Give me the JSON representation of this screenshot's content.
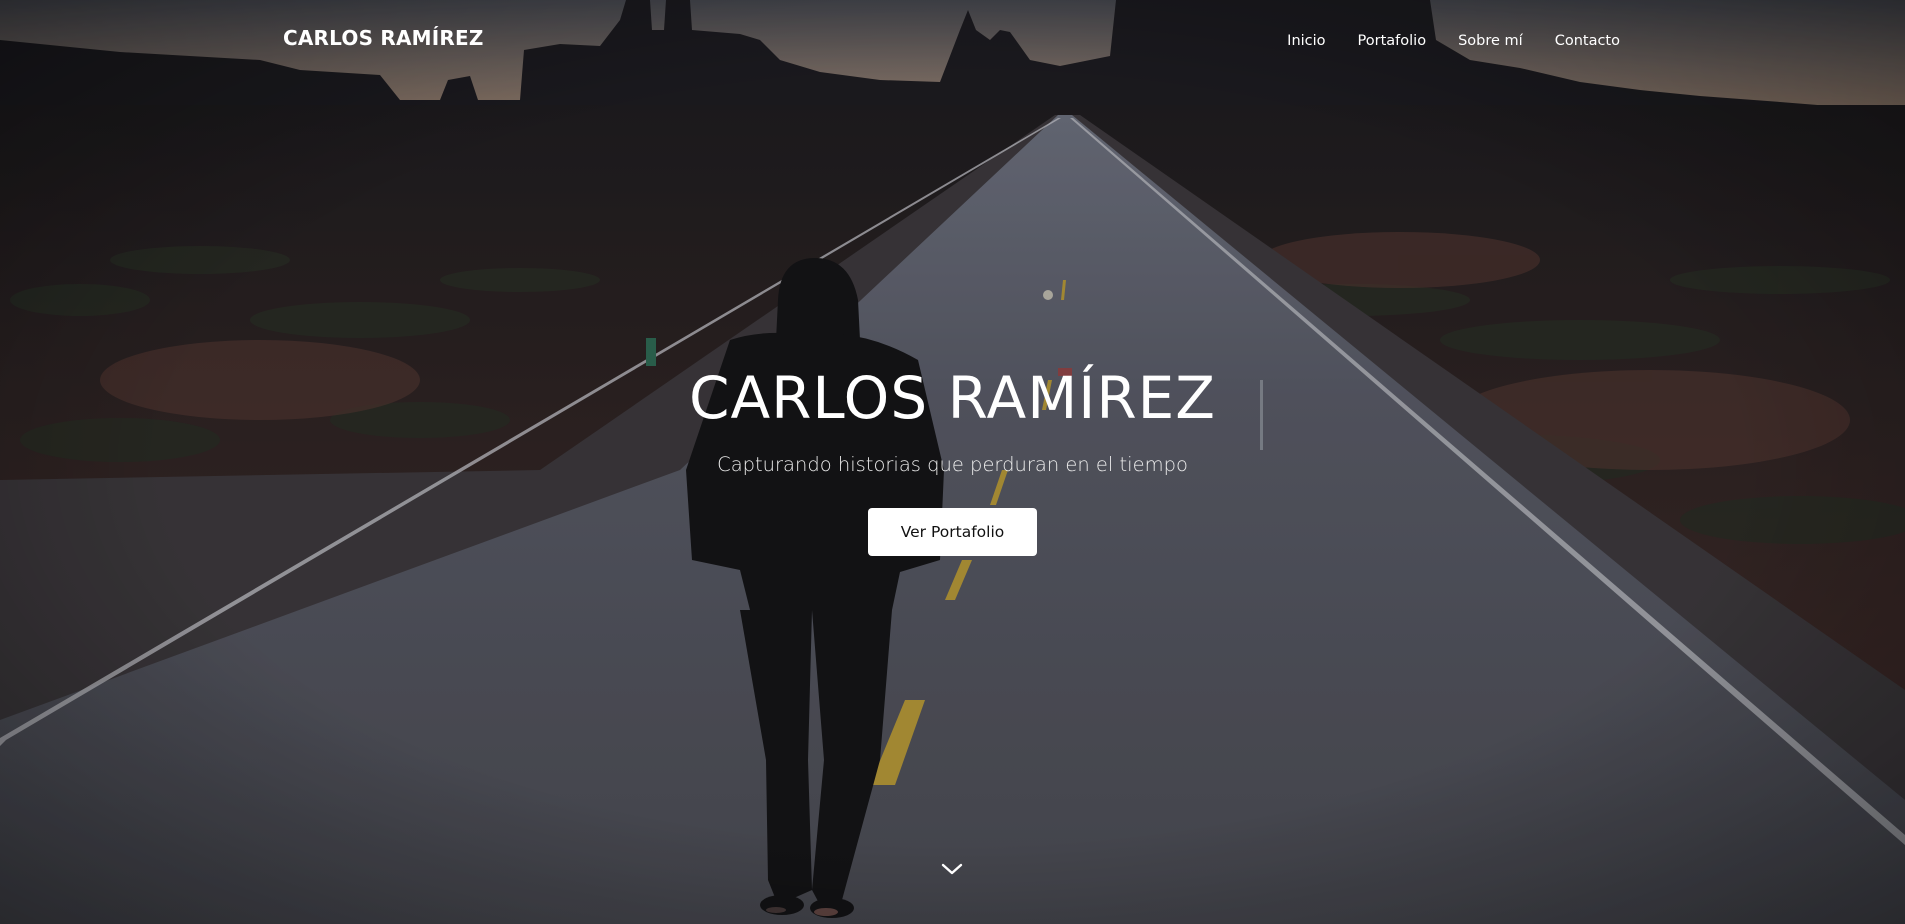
{
  "brand": {
    "name": "CARLOS RAMÍREZ"
  },
  "nav": {
    "items": [
      {
        "label": "Inicio"
      },
      {
        "label": "Portafolio"
      },
      {
        "label": "Sobre mí"
      },
      {
        "label": "Contacto"
      }
    ]
  },
  "hero": {
    "title": "CARLOS RAMÍREZ",
    "subtitle": "Capturando historias que perduran en el tiempo",
    "cta_label": "Ver Portafolio",
    "scroll_icon": "chevron-down-icon"
  },
  "colors": {
    "text": "#ffffff",
    "button_bg": "#ffffff",
    "button_text": "#111111",
    "sky_top": "#4f5158",
    "sky_horizon": "#8f7a6a",
    "road": "#5c5d66"
  }
}
